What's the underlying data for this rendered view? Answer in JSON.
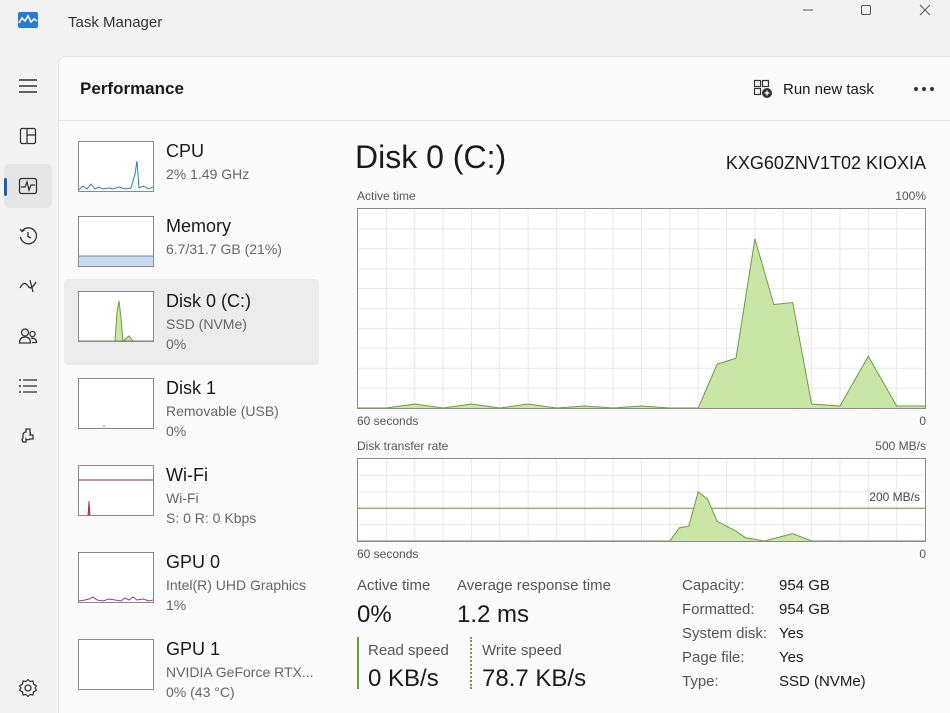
{
  "app": {
    "title": "Task Manager"
  },
  "header": {
    "title": "Performance",
    "run_task_label": "Run new task"
  },
  "nav": [
    {
      "name": "hamburger-icon"
    },
    {
      "name": "processes-icon"
    },
    {
      "name": "performance-icon"
    },
    {
      "name": "app-history-icon"
    },
    {
      "name": "startup-apps-icon"
    },
    {
      "name": "users-icon"
    },
    {
      "name": "details-icon"
    },
    {
      "name": "services-icon"
    },
    {
      "name": "settings-icon"
    }
  ],
  "resources": [
    {
      "name": "CPU",
      "line1": "2%  1.49 GHz",
      "line2": ""
    },
    {
      "name": "Memory",
      "line1": "6.7/31.7 GB (21%)",
      "line2": ""
    },
    {
      "name": "Disk 0 (C:)",
      "line1": "SSD (NVMe)",
      "line2": "0%"
    },
    {
      "name": "Disk 1",
      "line1": "Removable (USB)",
      "line2": "0%"
    },
    {
      "name": "Wi-Fi",
      "line1": "Wi-Fi",
      "line2": "S: 0  R: 0 Kbps"
    },
    {
      "name": "GPU 0",
      "line1": "Intel(R) UHD Graphics",
      "line2": "1%"
    },
    {
      "name": "GPU 1",
      "line1": "NVIDIA GeForce RTX...",
      "line2": "0%  (43 °C)"
    }
  ],
  "detail": {
    "title": "Disk 0 (C:)",
    "model": "KXG60ZNV1T02 KIOXIA",
    "active_graph": {
      "label": "Active time",
      "max": "100%",
      "xlabel": "60 seconds",
      "min": "0"
    },
    "transfer_graph": {
      "label": "Disk transfer rate",
      "max": "500 MB/s",
      "mid": "200 MB/s",
      "xlabel": "60 seconds",
      "min": "0"
    },
    "stats": {
      "active_time_label": "Active time",
      "active_time_value": "0%",
      "avg_resp_label": "Average response time",
      "avg_resp_value": "1.2 ms",
      "read_label": "Read speed",
      "read_value": "0 KB/s",
      "write_label": "Write speed",
      "write_value": "78.7 KB/s"
    },
    "properties": [
      {
        "key": "Capacity:",
        "value": "954 GB"
      },
      {
        "key": "Formatted:",
        "value": "954 GB"
      },
      {
        "key": "System disk:",
        "value": "Yes"
      },
      {
        "key": "Page file:",
        "value": "Yes"
      },
      {
        "key": "Type:",
        "value": "SSD (NVMe)"
      }
    ]
  },
  "chart_data": [
    {
      "type": "area",
      "title": "Active time",
      "xlabel": "60 seconds",
      "ylim": [
        0,
        100
      ],
      "x": [
        0,
        3,
        6,
        9,
        12,
        15,
        18,
        21,
        24,
        27,
        30,
        33,
        36,
        38,
        40,
        42,
        44,
        46,
        48,
        51,
        54,
        57,
        60
      ],
      "series": [
        {
          "values": [
            0,
            0,
            2,
            0,
            2,
            0,
            2,
            0,
            1,
            0,
            1,
            0,
            0,
            22,
            25,
            85,
            52,
            53,
            2,
            1,
            26,
            1,
            1
          ]
        }
      ],
      "color": "#6a9f3a"
    },
    {
      "type": "area",
      "title": "Disk transfer rate",
      "xlabel": "60 seconds",
      "ylim": [
        0,
        500
      ],
      "x": [
        0,
        30,
        33,
        34,
        35,
        36,
        37,
        38,
        39,
        40,
        41,
        43,
        46,
        48,
        60
      ],
      "series": [
        {
          "values": [
            0,
            0,
            0,
            80,
            90,
            300,
            255,
            120,
            90,
            60,
            20,
            0,
            45,
            0,
            0
          ]
        }
      ],
      "color": "#6a9f3a"
    }
  ],
  "colors": {
    "accent": "#1a5fb4",
    "disk_green": "#6a9f3a",
    "disk_fill": "#c9e6a7",
    "memory_blue": "#5b93c7",
    "wifi_red": "#a21c4c",
    "gpu_purple": "#7d3fb0"
  }
}
